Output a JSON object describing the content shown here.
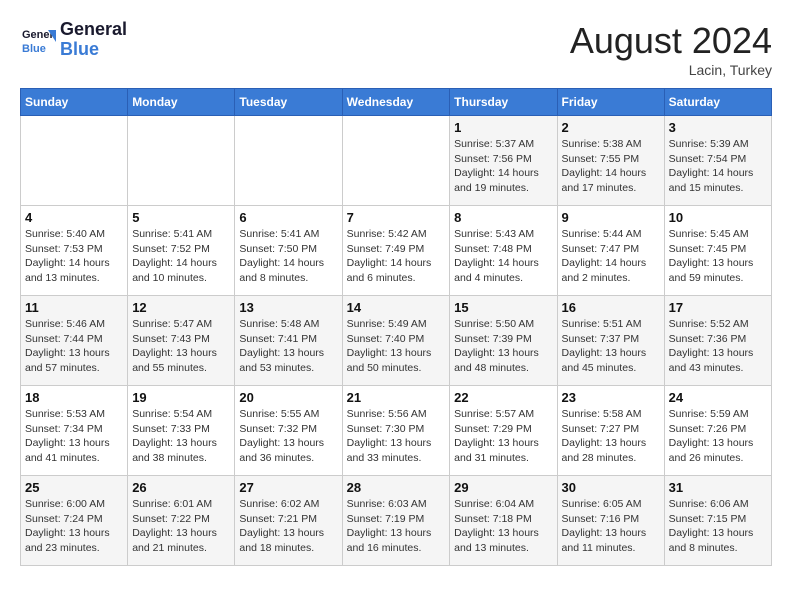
{
  "header": {
    "logo_line1": "General",
    "logo_line2": "Blue",
    "month": "August 2024",
    "location": "Lacin, Turkey"
  },
  "weekdays": [
    "Sunday",
    "Monday",
    "Tuesday",
    "Wednesday",
    "Thursday",
    "Friday",
    "Saturday"
  ],
  "weeks": [
    [
      {
        "day": "",
        "info": ""
      },
      {
        "day": "",
        "info": ""
      },
      {
        "day": "",
        "info": ""
      },
      {
        "day": "",
        "info": ""
      },
      {
        "day": "1",
        "info": "Sunrise: 5:37 AM\nSunset: 7:56 PM\nDaylight: 14 hours\nand 19 minutes."
      },
      {
        "day": "2",
        "info": "Sunrise: 5:38 AM\nSunset: 7:55 PM\nDaylight: 14 hours\nand 17 minutes."
      },
      {
        "day": "3",
        "info": "Sunrise: 5:39 AM\nSunset: 7:54 PM\nDaylight: 14 hours\nand 15 minutes."
      }
    ],
    [
      {
        "day": "4",
        "info": "Sunrise: 5:40 AM\nSunset: 7:53 PM\nDaylight: 14 hours\nand 13 minutes."
      },
      {
        "day": "5",
        "info": "Sunrise: 5:41 AM\nSunset: 7:52 PM\nDaylight: 14 hours\nand 10 minutes."
      },
      {
        "day": "6",
        "info": "Sunrise: 5:41 AM\nSunset: 7:50 PM\nDaylight: 14 hours\nand 8 minutes."
      },
      {
        "day": "7",
        "info": "Sunrise: 5:42 AM\nSunset: 7:49 PM\nDaylight: 14 hours\nand 6 minutes."
      },
      {
        "day": "8",
        "info": "Sunrise: 5:43 AM\nSunset: 7:48 PM\nDaylight: 14 hours\nand 4 minutes."
      },
      {
        "day": "9",
        "info": "Sunrise: 5:44 AM\nSunset: 7:47 PM\nDaylight: 14 hours\nand 2 minutes."
      },
      {
        "day": "10",
        "info": "Sunrise: 5:45 AM\nSunset: 7:45 PM\nDaylight: 13 hours\nand 59 minutes."
      }
    ],
    [
      {
        "day": "11",
        "info": "Sunrise: 5:46 AM\nSunset: 7:44 PM\nDaylight: 13 hours\nand 57 minutes."
      },
      {
        "day": "12",
        "info": "Sunrise: 5:47 AM\nSunset: 7:43 PM\nDaylight: 13 hours\nand 55 minutes."
      },
      {
        "day": "13",
        "info": "Sunrise: 5:48 AM\nSunset: 7:41 PM\nDaylight: 13 hours\nand 53 minutes."
      },
      {
        "day": "14",
        "info": "Sunrise: 5:49 AM\nSunset: 7:40 PM\nDaylight: 13 hours\nand 50 minutes."
      },
      {
        "day": "15",
        "info": "Sunrise: 5:50 AM\nSunset: 7:39 PM\nDaylight: 13 hours\nand 48 minutes."
      },
      {
        "day": "16",
        "info": "Sunrise: 5:51 AM\nSunset: 7:37 PM\nDaylight: 13 hours\nand 45 minutes."
      },
      {
        "day": "17",
        "info": "Sunrise: 5:52 AM\nSunset: 7:36 PM\nDaylight: 13 hours\nand 43 minutes."
      }
    ],
    [
      {
        "day": "18",
        "info": "Sunrise: 5:53 AM\nSunset: 7:34 PM\nDaylight: 13 hours\nand 41 minutes."
      },
      {
        "day": "19",
        "info": "Sunrise: 5:54 AM\nSunset: 7:33 PM\nDaylight: 13 hours\nand 38 minutes."
      },
      {
        "day": "20",
        "info": "Sunrise: 5:55 AM\nSunset: 7:32 PM\nDaylight: 13 hours\nand 36 minutes."
      },
      {
        "day": "21",
        "info": "Sunrise: 5:56 AM\nSunset: 7:30 PM\nDaylight: 13 hours\nand 33 minutes."
      },
      {
        "day": "22",
        "info": "Sunrise: 5:57 AM\nSunset: 7:29 PM\nDaylight: 13 hours\nand 31 minutes."
      },
      {
        "day": "23",
        "info": "Sunrise: 5:58 AM\nSunset: 7:27 PM\nDaylight: 13 hours\nand 28 minutes."
      },
      {
        "day": "24",
        "info": "Sunrise: 5:59 AM\nSunset: 7:26 PM\nDaylight: 13 hours\nand 26 minutes."
      }
    ],
    [
      {
        "day": "25",
        "info": "Sunrise: 6:00 AM\nSunset: 7:24 PM\nDaylight: 13 hours\nand 23 minutes."
      },
      {
        "day": "26",
        "info": "Sunrise: 6:01 AM\nSunset: 7:22 PM\nDaylight: 13 hours\nand 21 minutes."
      },
      {
        "day": "27",
        "info": "Sunrise: 6:02 AM\nSunset: 7:21 PM\nDaylight: 13 hours\nand 18 minutes."
      },
      {
        "day": "28",
        "info": "Sunrise: 6:03 AM\nSunset: 7:19 PM\nDaylight: 13 hours\nand 16 minutes."
      },
      {
        "day": "29",
        "info": "Sunrise: 6:04 AM\nSunset: 7:18 PM\nDaylight: 13 hours\nand 13 minutes."
      },
      {
        "day": "30",
        "info": "Sunrise: 6:05 AM\nSunset: 7:16 PM\nDaylight: 13 hours\nand 11 minutes."
      },
      {
        "day": "31",
        "info": "Sunrise: 6:06 AM\nSunset: 7:15 PM\nDaylight: 13 hours\nand 8 minutes."
      }
    ]
  ]
}
